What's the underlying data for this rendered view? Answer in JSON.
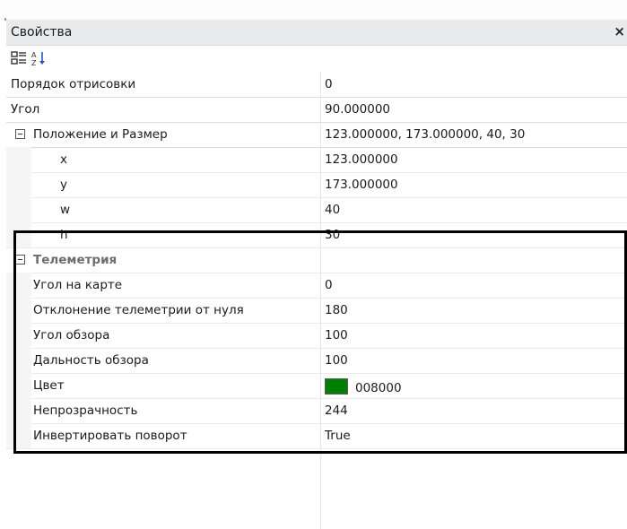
{
  "panel": {
    "title": "Свойства",
    "close": "×"
  },
  "toolbar": {
    "categorized_icon": "categorized-icon",
    "alphabetical_icon": "sort-alphabetical-icon"
  },
  "rows": [
    {
      "name": "Порядок отрисовки",
      "value": "0"
    },
    {
      "name": "Угол",
      "value": "90.000000"
    },
    {
      "name": "Положение и Размер",
      "value": "123.000000, 173.000000, 40, 30",
      "expanded": true
    },
    {
      "name": "x",
      "value": "123.000000"
    },
    {
      "name": "y",
      "value": "173.000000"
    },
    {
      "name": "w",
      "value": "40"
    },
    {
      "name": "h",
      "value": "30"
    }
  ],
  "telemetry": {
    "category": "Телеметрия",
    "expanded": true,
    "rows": [
      {
        "name": "Угол на карте",
        "value": "0"
      },
      {
        "name": "Отклонение телеметрии от нуля",
        "value": "180"
      },
      {
        "name": "Угол обзора",
        "value": "100"
      },
      {
        "name": "Дальность обзора",
        "value": "100"
      },
      {
        "name": "Цвет",
        "value": "008000",
        "swatch_color": "#008000"
      },
      {
        "name": "Непрозрачность",
        "value": "244"
      },
      {
        "name": "Инвертировать поворот",
        "value": "True"
      }
    ]
  }
}
